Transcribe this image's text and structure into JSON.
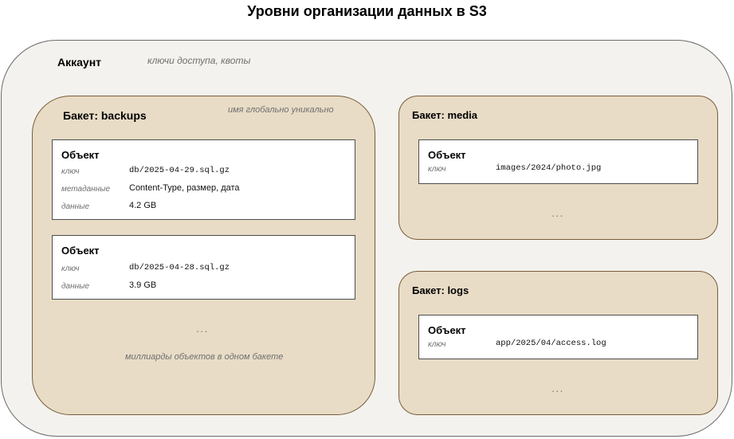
{
  "title": "Уровни организации данных в S3",
  "account": {
    "label": "Аккаунт",
    "note": "ключи доступа, квоты"
  },
  "buckets": [
    {
      "label": "Бакет: backups",
      "note": "имя глобально уникально",
      "objects": [
        {
          "label": "Объект",
          "rows": [
            {
              "key": "ключ",
              "value": "db/2025-04-29.sql.gz"
            },
            {
              "key": "метаданные",
              "value": "Content-Type, размер, дата"
            },
            {
              "key": "данные",
              "value": "4.2 GB"
            }
          ]
        },
        {
          "label": "Объект",
          "rows": [
            {
              "key": "ключ",
              "value": "db/2025-04-28.sql.gz"
            },
            {
              "key": "данные",
              "value": "3.9 GB"
            }
          ]
        }
      ],
      "ellipsis": "...",
      "footer_note": "миллиарды объектов в одном бакете"
    },
    {
      "label": "Бакет: media",
      "objects": [
        {
          "label": "Объект",
          "rows": [
            {
              "key": "ключ",
              "value": "images/2024/photo.jpg"
            }
          ]
        }
      ],
      "ellipsis": "..."
    },
    {
      "label": "Бакет: logs",
      "objects": [
        {
          "label": "Объект",
          "rows": [
            {
              "key": "ключ",
              "value": "app/2025/04/access.log"
            }
          ]
        }
      ],
      "ellipsis": "..."
    }
  ],
  "colors": {
    "account_fill": "#f3f2ee",
    "bucket_fill": "#e8dcc6",
    "bucket_border": "#7a5c3a",
    "object_fill": "#ffffff"
  }
}
